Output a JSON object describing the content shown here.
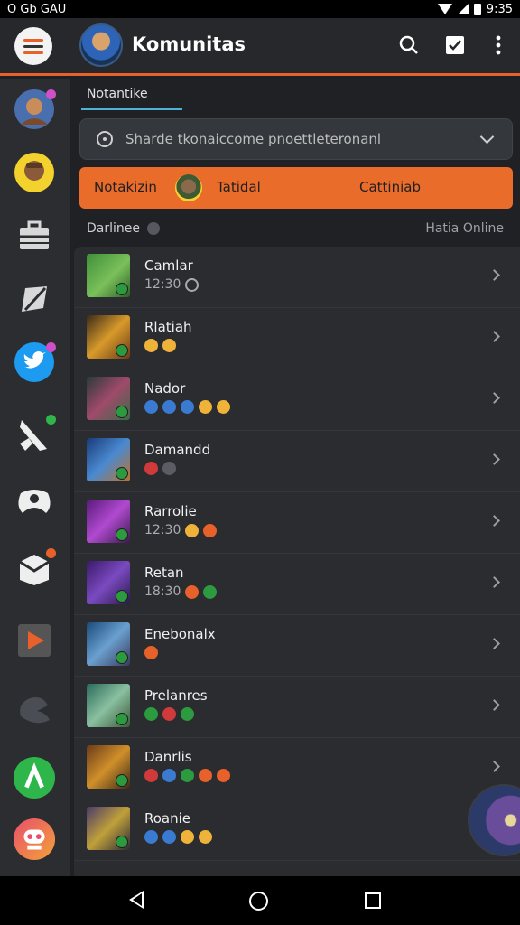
{
  "status_bar": {
    "left_text": "O Gb GAU",
    "time": "9:35"
  },
  "header": {
    "title": "Komunitas"
  },
  "sidebar": {
    "items": [
      {
        "icon": "game-avatar-icon",
        "badge_color": "#d050c8"
      },
      {
        "icon": "character-avatar-icon"
      },
      {
        "icon": "briefcase-icon"
      },
      {
        "icon": "paper-plane-icon"
      },
      {
        "icon": "twitter-icon",
        "badge_color": "#d050c8"
      },
      {
        "icon": "sword-icon",
        "badge_color": "#2fb64a"
      },
      {
        "icon": "controller-icon"
      },
      {
        "icon": "mail-icon",
        "badge_color": "#e8612a"
      },
      {
        "icon": "video-play-icon"
      },
      {
        "icon": "cloud-icon"
      },
      {
        "icon": "signal-icon"
      },
      {
        "icon": "robot-icon"
      }
    ]
  },
  "main": {
    "tab_label": "Notantike",
    "search": {
      "placeholder": "Sharde tkonaiccome pnoettleteronanl"
    },
    "banner": {
      "left": "Notakizin",
      "middle": "Tatidal",
      "right": "Cattiniab"
    },
    "section": {
      "left_label": "Darlinee",
      "right_label": "Hatia Online"
    },
    "rows": [
      {
        "name": "Camlar",
        "sub": "12:30"
      },
      {
        "name": "Rlatiah",
        "sub": ""
      },
      {
        "name": "Nador",
        "sub": ""
      },
      {
        "name": "Damandd",
        "sub": ""
      },
      {
        "name": "Rarrolie",
        "sub": "12:30"
      },
      {
        "name": "Retan",
        "sub": "18:30"
      },
      {
        "name": "Enebonalx",
        "sub": ""
      },
      {
        "name": "Prelanres",
        "sub": ""
      },
      {
        "name": "Danrlis",
        "sub": ""
      },
      {
        "name": "Roanie",
        "sub": ""
      }
    ]
  },
  "colors": {
    "accent": "#e8612a",
    "tab_underline": "#4fb3d9",
    "background": "#1e2024"
  }
}
